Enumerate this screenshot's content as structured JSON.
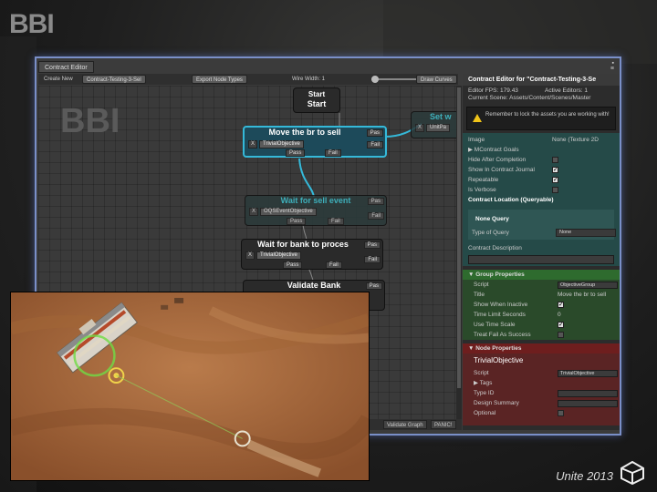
{
  "slide": {
    "brand_logo": "BBI",
    "event_label": "Unite 2013",
    "unity_logo": "unity-logo-icon"
  },
  "editor": {
    "tab_title": "Contract Editor",
    "window_controls": [
      "▪",
      "≡"
    ],
    "toolbar": {
      "create_new": "Create New",
      "contract_name": "Contract-Testing-3-Sel",
      "export_node_types": "Export Node Types",
      "wire_width": "Wire Width: 1",
      "draw_curves": "Draw Curves"
    },
    "canvas_logo": "BBI",
    "nodes": [
      {
        "title": "Start",
        "subtitle": "Start"
      },
      {
        "title": "Move the br to sell",
        "field": "TrivialObjective",
        "pass": "Pass",
        "fail": "Fail",
        "port": "Pas"
      },
      {
        "title": "Set w",
        "field": "UnitPa"
      },
      {
        "title": "Wait for sell event",
        "field": "OQSEventObjective",
        "pass": "Pass",
        "fail": "Fail",
        "port": "Pas"
      },
      {
        "title": "Wait for bank to proces",
        "field": "TrivialObjective",
        "pass": "Pass",
        "fail": "Fail",
        "port": "Pas"
      },
      {
        "title": "Validate Bank",
        "port": "Pas"
      }
    ],
    "remove_glyph": "X",
    "bottom_bar": {
      "validate_graph": "Validate Graph",
      "panic": "PANIC!"
    }
  },
  "inspector": {
    "title": "Contract Editor for \"Contract-Testing-3-Se",
    "fps": "Editor FPS: 179.43",
    "active_editors": "Active Editors: 1",
    "current_scene": "Current Scene: Assets/Content/Scenes/Master",
    "warning": "Remember to lock the assets you are working with!",
    "contract_props": [
      {
        "label": "Image",
        "value": "None (Texture 2D"
      },
      {
        "label": "▶ MContract Goals",
        "value": ""
      },
      {
        "label": "Hide After Completion",
        "checked": false
      },
      {
        "label": "Show In Contract Journal",
        "checked": true
      },
      {
        "label": "Repeatable",
        "checked": true
      },
      {
        "label": "Is Verbose",
        "checked": false
      }
    ],
    "contract_location": "Contract Location (Queryable)",
    "none_query": "None Query",
    "type_of_query_label": "Type of Query",
    "type_of_query_value": "None",
    "contract_description": "Contract Description",
    "group_properties": {
      "header": "▼ Group Properties",
      "rows": [
        {
          "label": "Script",
          "value": "ObjectiveGroup"
        },
        {
          "label": "Title",
          "value": "Move the br to sell"
        },
        {
          "label": "Show When Inactive",
          "checked": true
        },
        {
          "label": "Time Limit Seconds",
          "value": "0"
        },
        {
          "label": "Use Time Scale",
          "checked": true
        },
        {
          "label": "Treat Fail As Success",
          "checked": false
        }
      ]
    },
    "node_properties": {
      "header": "▼ Node Properties",
      "type": "TrivialObjective",
      "rows": [
        {
          "label": "Script",
          "value": "TrivialObjective"
        },
        {
          "label": "▶ Tags",
          "value": ""
        },
        {
          "label": "Type ID",
          "value": ""
        },
        {
          "label": "Design Summary",
          "value": ""
        },
        {
          "label": "Optional",
          "checked": false
        }
      ]
    }
  },
  "colors": {
    "selected_node_border": "#35b9d9",
    "wire": "#35b9d9",
    "group_header": "#2e6b2e",
    "node_header": "#6e1e1e",
    "window_glow": "#7a8fc8"
  }
}
